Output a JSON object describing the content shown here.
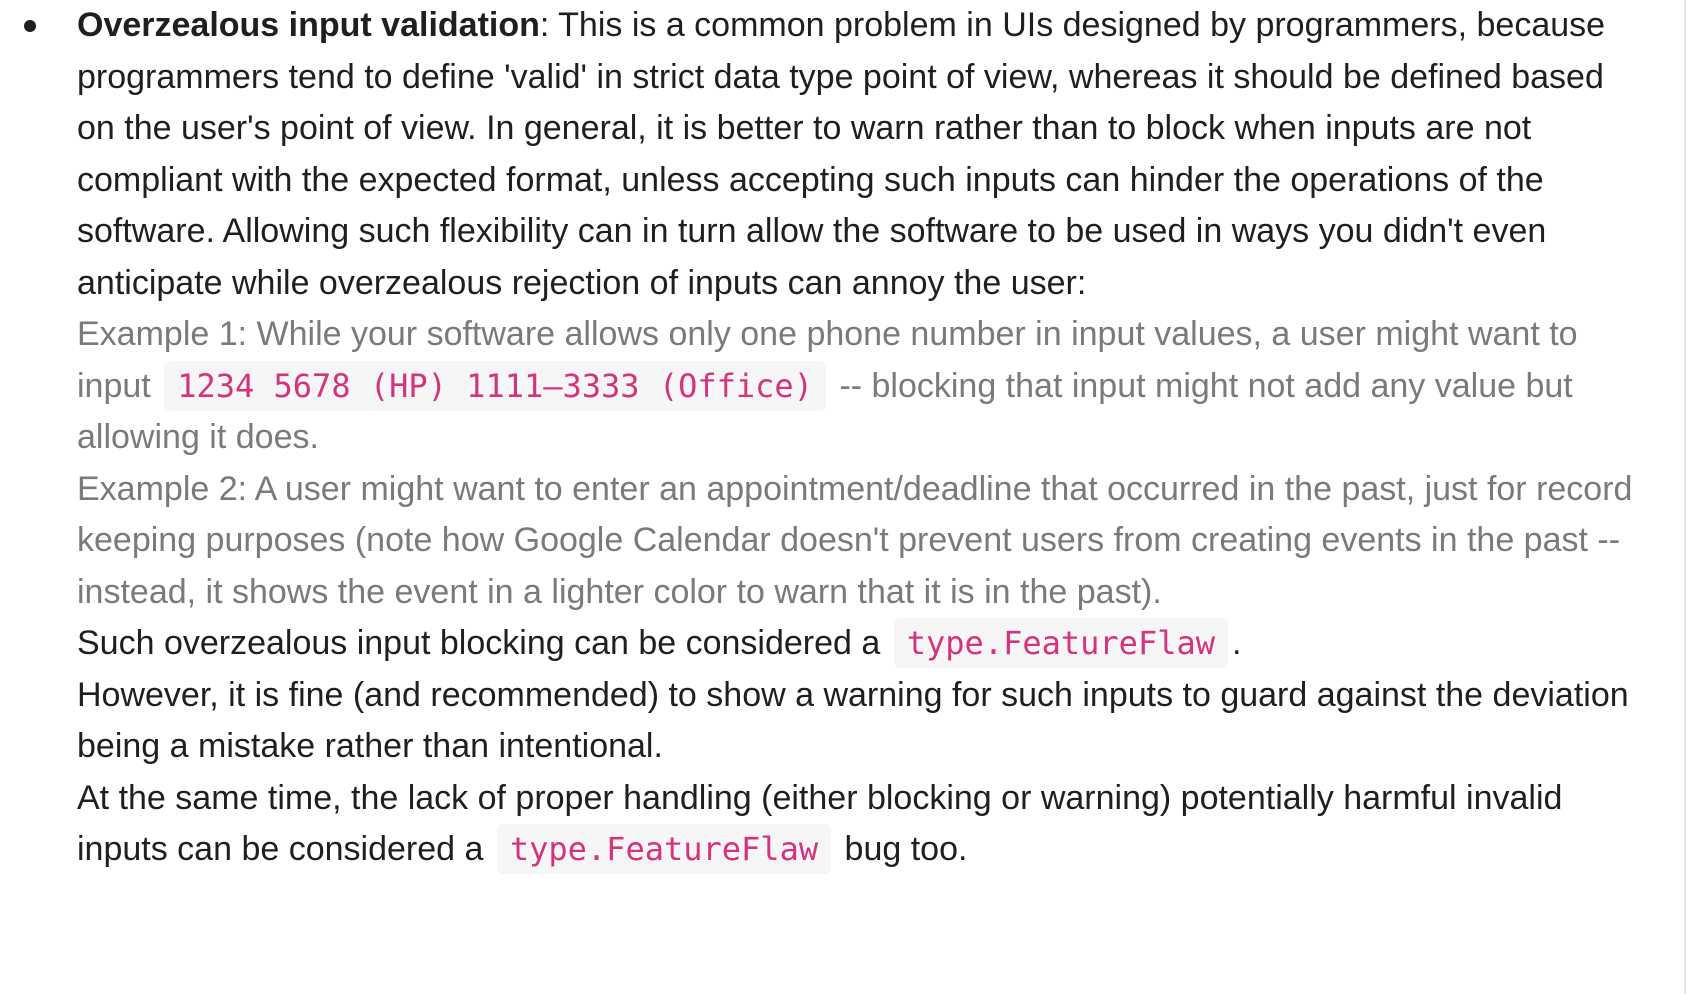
{
  "item": {
    "term": "Overzealous input validation",
    "intro": ": This is a common problem in UIs designed by programmers, because programmers tend to define 'valid' in strict data type point of view, whereas it should be defined based on the user's point of view. In general, it is better to warn rather than to block when inputs are not compliant with the expected format, unless accepting such inputs can hinder the operations of the software. Allowing such flexibility can in turn allow the software to be used in ways you didn't even anticipate while overzealous rejection of inputs can annoy the user:",
    "example1": {
      "before": "Example 1: While your software allows only one phone number in input values, a user might want to input ",
      "code": "1234 5678 (HP) 1111–3333 (Office)",
      "after": " -- blocking that input might not add any value but allowing it does."
    },
    "example2": "Example 2: A user might want to enter an appointment/deadline that occurred in the past, just for record keeping purposes (note how Google Calendar doesn't prevent users from creating events in the past -- instead, it shows the event in a lighter color to warn that it is in the past).",
    "conclusion": {
      "before": "Such overzealous input blocking can be considered a ",
      "code": "type.FeatureFlaw",
      "after": "."
    },
    "however": "However, it is fine (and recommended) to show a warning for such inputs to guard against the deviation being a mistake rather than intentional.",
    "same_time": {
      "before": "At the same time, the lack of proper handling (either blocking or warning) potentially harmful invalid inputs can be considered a ",
      "code": "type.FeatureFlaw",
      "after": " bug too."
    }
  }
}
